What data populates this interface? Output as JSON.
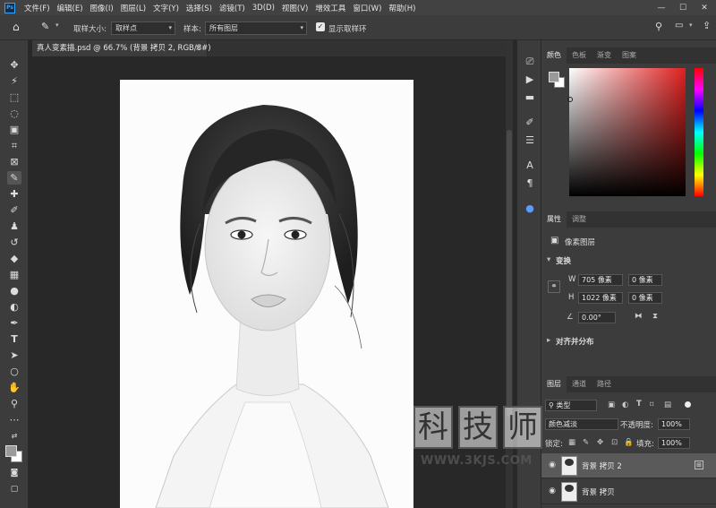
{
  "menubar": {
    "logo": "Ps",
    "items": [
      "文件(F)",
      "编辑(E)",
      "图像(I)",
      "图层(L)",
      "文字(Y)",
      "选择(S)",
      "滤镜(T)",
      "3D(D)",
      "视图(V)",
      "增效工具",
      "窗口(W)",
      "帮助(H)"
    ],
    "minimize": "—",
    "maximize": "☐",
    "close": "✕"
  },
  "optbar": {
    "sample_size_label": "取样大小:",
    "sample_size_value": "取样点",
    "sample_label": "样本:",
    "sample_value": "所有图层",
    "show_ring_label": "显示取样环"
  },
  "document": {
    "tab_title": "真人变素描.psd @ 66.7% (背景 拷贝 2, RGB/8#)",
    "tab_close": "×"
  },
  "color_panel": {
    "tabs": [
      "颜色",
      "色板",
      "渐变",
      "图案"
    ],
    "foreground": "#9a9a9a",
    "background": "#ffffff"
  },
  "properties_panel": {
    "tabs": [
      "属性",
      "调整"
    ],
    "layer_type": "像素图层",
    "transform_header": "变换",
    "w_label": "W",
    "w_value": "705 像素",
    "h_label": "H",
    "h_value": "1022 像素",
    "x_label": "X",
    "x_value": "0 像素",
    "y_label": "Y",
    "y_value": "0 像素",
    "angle_value": "0.00°",
    "align_header": "对齐并分布"
  },
  "layers_panel": {
    "tabs": [
      "图层",
      "通道",
      "路径"
    ],
    "filter_type": "类型",
    "blend_mode": "颜色减淡",
    "opacity_label": "不透明度:",
    "opacity_value": "100%",
    "lock_label": "锁定:",
    "fill_label": "填充:",
    "fill_value": "100%",
    "layers": [
      {
        "name": "背景 拷贝 2",
        "selected": true
      },
      {
        "name": "背景 拷贝",
        "selected": false
      }
    ]
  },
  "watermark": {
    "chars": [
      "科",
      "技",
      "师"
    ],
    "url": "WWW.3KJS.COM"
  }
}
